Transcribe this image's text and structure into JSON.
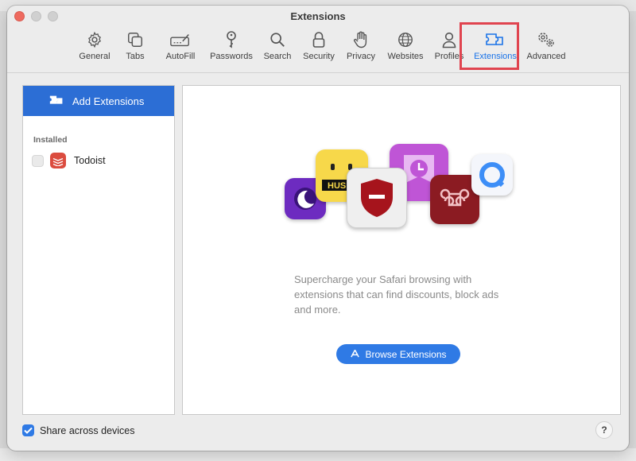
{
  "window": {
    "title": "Extensions"
  },
  "toolbar": {
    "items": [
      {
        "label": "General",
        "icon": "gear-icon"
      },
      {
        "label": "Tabs",
        "icon": "tabs-icon"
      },
      {
        "label": "AutoFill",
        "icon": "autofill-icon"
      },
      {
        "label": "Passwords",
        "icon": "key-icon"
      },
      {
        "label": "Search",
        "icon": "magnifier-icon"
      },
      {
        "label": "Security",
        "icon": "lock-icon"
      },
      {
        "label": "Privacy",
        "icon": "hand-icon"
      },
      {
        "label": "Websites",
        "icon": "globe-icon"
      },
      {
        "label": "Profiles",
        "icon": "person-icon"
      },
      {
        "label": "Extensions",
        "icon": "puzzle-icon",
        "selected": true
      },
      {
        "label": "Advanced",
        "icon": "gears-icon"
      }
    ],
    "accent_color": "#1a73e8",
    "highlight_color": "#e0444f"
  },
  "sidebar": {
    "add_button_label": "Add Extensions",
    "section_label": "Installed",
    "extensions": [
      {
        "name": "Todoist",
        "enabled": false
      }
    ]
  },
  "main": {
    "description": "Supercharge your Safari browsing with extensions that can find discounts, block ads and more.",
    "browse_button_label": "Browse Extensions",
    "hero_tile_text": "HUSH"
  },
  "footer": {
    "share_label": "Share across devices",
    "share_checked": true,
    "help_label": "?"
  }
}
